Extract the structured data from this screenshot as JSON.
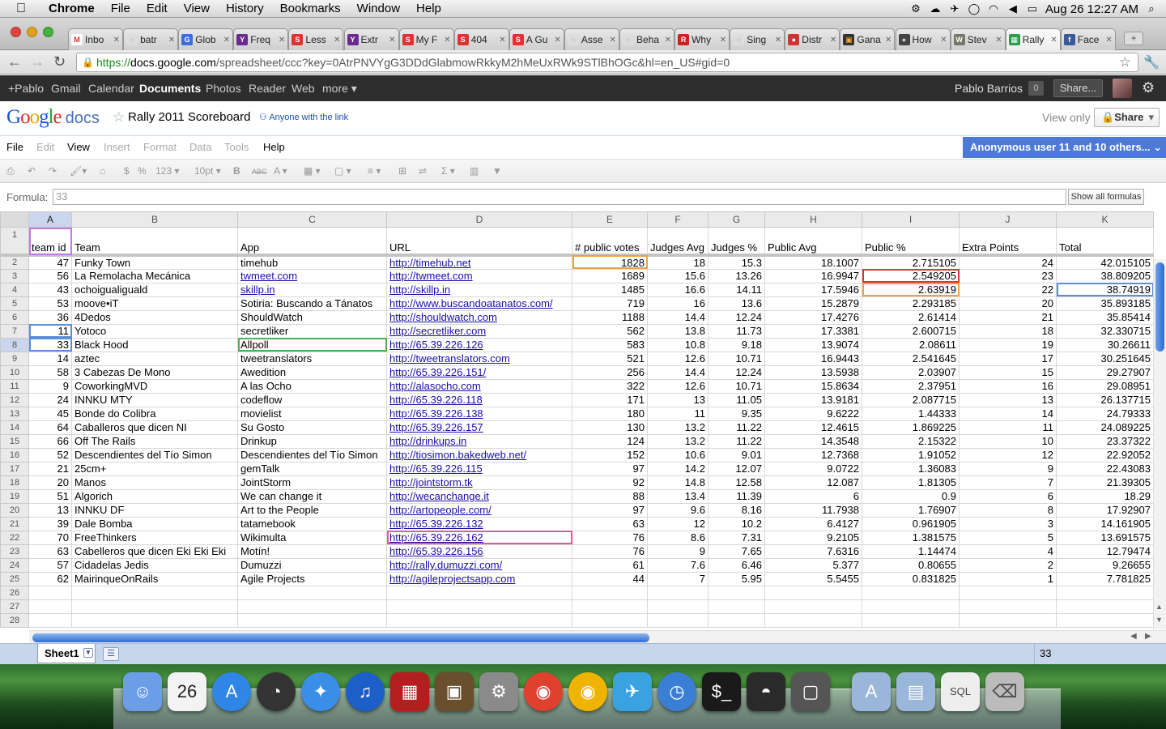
{
  "macos": {
    "menu": [
      "File",
      "Edit",
      "View",
      "History",
      "Bookmarks",
      "Window",
      "Help"
    ],
    "app": "Chrome",
    "datetime": "Aug 26  12:27 AM"
  },
  "tabs": [
    {
      "label": "Inbo",
      "color": "#ffffff",
      "glyph": "M",
      "fg": "#d33"
    },
    {
      "label": "batr",
      "color": "#dddddd",
      "glyph": "◌",
      "fg": "#666"
    },
    {
      "label": "Glob",
      "color": "#3b6fd8",
      "glyph": "G",
      "fg": "#fff"
    },
    {
      "label": "Freq",
      "color": "#6b2a8f",
      "glyph": "Y",
      "fg": "#fff"
    },
    {
      "label": "Less",
      "color": "#d33",
      "glyph": "S",
      "fg": "#fff"
    },
    {
      "label": "Extr",
      "color": "#6b2a8f",
      "glyph": "Y",
      "fg": "#fff"
    },
    {
      "label": "My F",
      "color": "#d33",
      "glyph": "S",
      "fg": "#fff"
    },
    {
      "label": "404",
      "color": "#d33",
      "glyph": "S",
      "fg": "#fff"
    },
    {
      "label": "A Gu",
      "color": "#d33",
      "glyph": "S",
      "fg": "#fff"
    },
    {
      "label": "Asse",
      "color": "#dddddd",
      "glyph": "◌",
      "fg": "#666"
    },
    {
      "label": "Beha",
      "color": "#dddddd",
      "glyph": "◌",
      "fg": "#666"
    },
    {
      "label": "Why",
      "color": "#c22",
      "glyph": "R",
      "fg": "#fff"
    },
    {
      "label": "Sing",
      "color": "#dddddd",
      "glyph": "◌",
      "fg": "#666"
    },
    {
      "label": "Distr",
      "color": "#c33",
      "glyph": "●",
      "fg": "#fff"
    },
    {
      "label": "Gana",
      "color": "#333",
      "glyph": "▣",
      "fg": "#fa3"
    },
    {
      "label": "How",
      "color": "#444",
      "glyph": "●",
      "fg": "#ccc"
    },
    {
      "label": "Stev",
      "color": "#776",
      "glyph": "W",
      "fg": "#fff"
    },
    {
      "label": "Rally",
      "color": "#2e9e48",
      "glyph": "▦",
      "fg": "#fff"
    },
    {
      "label": "Face",
      "color": "#3b5998",
      "glyph": "f",
      "fg": "#fff"
    }
  ],
  "address": {
    "scheme": "https://",
    "host": "docs.google.com",
    "path": "/spreadsheet/ccc?key=0AtrPNVYgG3DDdGlabmowRkkyM2hMeUxRWk9STlBhOGc&hl=en_US#gid=0"
  },
  "googlebar": {
    "links": [
      "+Pablo",
      "Gmail",
      "Calendar",
      "Documents",
      "Photos",
      "Reader",
      "Web",
      "more ▾"
    ],
    "active": "Documents",
    "user": "Pablo Barrios",
    "count": "0",
    "share": "Share..."
  },
  "doc": {
    "logo_google": "Google",
    "logo_docs": "docs",
    "title": "Rally 2011 Scoreboard",
    "visibility": "Anyone with the link",
    "view_only": "View only",
    "share": "Share"
  },
  "menubar": {
    "items": [
      {
        "label": "File",
        "enabled": true
      },
      {
        "label": "Edit",
        "enabled": false
      },
      {
        "label": "View",
        "enabled": true
      },
      {
        "label": "Insert",
        "enabled": false
      },
      {
        "label": "Format",
        "enabled": false
      },
      {
        "label": "Data",
        "enabled": false
      },
      {
        "label": "Tools",
        "enabled": false
      },
      {
        "label": "Help",
        "enabled": true
      }
    ],
    "collaborators": "Anonymous user 11 and 10 others... ⌄"
  },
  "toolbar": {
    "items": [
      "⎙",
      "↶",
      "↷",
      "🖌▾",
      "⌂",
      "$",
      "%",
      "123 ▾",
      "10pt ▾",
      "B",
      "ABC",
      "A ▾",
      "▦ ▾",
      "▢ ▾",
      "≡ ▾",
      "⊞",
      "⇌",
      "Σ ▾",
      "▥",
      "▼"
    ]
  },
  "formula": {
    "label": "Formula:",
    "value": "33",
    "show_all": "Show all formulas"
  },
  "grid": {
    "columns": [
      "A",
      "B",
      "C",
      "D",
      "E",
      "F",
      "G",
      "H",
      "I",
      "J",
      "K"
    ],
    "header_row": [
      "team id",
      "Team",
      "App",
      "URL",
      "# public votes",
      "Judges Avg",
      "Judges %",
      "Public Avg",
      "Public %",
      "Extra Points",
      "Total"
    ],
    "rows": [
      [
        "47",
        "Funky Town",
        "timehub",
        "http://timehub.net",
        "1828",
        "18",
        "15.3",
        "18.1007",
        "2.715105",
        "24",
        "42.015105"
      ],
      [
        "56",
        "La Remolacha Mecánica",
        "twmeet.com",
        "http://twmeet.com",
        "1689",
        "15.6",
        "13.26",
        "16.9947",
        "2.549205",
        "23",
        "38.809205"
      ],
      [
        "43",
        "ochoigualiguald",
        "skillp.in",
        "http://skillp.in",
        "1485",
        "16.6",
        "14.11",
        "17.5946",
        "2.63919",
        "22",
        "38.74919"
      ],
      [
        "53",
        "moove•iT",
        "Sotiria: Buscando a Tánatos",
        "http://www.buscandoatanatos.com/",
        "719",
        "16",
        "13.6",
        "15.2879",
        "2.293185",
        "20",
        "35.893185"
      ],
      [
        "36",
        "4Dedos",
        "ShouldWatch",
        "http://shouldwatch.com",
        "1188",
        "14.4",
        "12.24",
        "17.4276",
        "2.61414",
        "21",
        "35.85414"
      ],
      [
        "11",
        "Yotoco",
        "secretliker",
        "http://secretliker.com",
        "562",
        "13.8",
        "11.73",
        "17.3381",
        "2.600715",
        "18",
        "32.330715"
      ],
      [
        "33",
        "Black Hood",
        "Allpoll",
        "http://65.39.226.126",
        "583",
        "10.8",
        "9.18",
        "13.9074",
        "2.08611",
        "19",
        "30.26611"
      ],
      [
        "14",
        "aztec",
        "tweetranslators",
        "http://tweetranslators.com",
        "521",
        "12.6",
        "10.71",
        "16.9443",
        "2.541645",
        "17",
        "30.251645"
      ],
      [
        "58",
        "3 Cabezas De Mono",
        "Awedition",
        "http://65.39.226.151/",
        "256",
        "14.4",
        "12.24",
        "13.5938",
        "2.03907",
        "15",
        "29.27907"
      ],
      [
        "9",
        "CoworkingMVD",
        "A las Ocho",
        "http://alasocho.com",
        "322",
        "12.6",
        "10.71",
        "15.8634",
        "2.37951",
        "16",
        "29.08951"
      ],
      [
        "24",
        "INNKU MTY",
        "codeflow",
        "http://65.39.226.118",
        "171",
        "13",
        "11.05",
        "13.9181",
        "2.087715",
        "13",
        "26.137715"
      ],
      [
        "45",
        "Bonde do Colibra",
        "movielist",
        "http://65.39.226.138",
        "180",
        "11",
        "9.35",
        "9.6222",
        "1.44333",
        "14",
        "24.79333"
      ],
      [
        "64",
        "Caballeros que dicen NI",
        "Su Gosto",
        "http://65.39.226.157",
        "130",
        "13.2",
        "11.22",
        "12.4615",
        "1.869225",
        "11",
        "24.089225"
      ],
      [
        "66",
        "Off The Rails",
        "Drinkup",
        "http://drinkups.in",
        "124",
        "13.2",
        "11.22",
        "14.3548",
        "2.15322",
        "10",
        "23.37322"
      ],
      [
        "52",
        "Descendientes del Tío Simon",
        "Descendientes del Tío Simon",
        "http://tiosimon.bakedweb.net/",
        "152",
        "10.6",
        "9.01",
        "12.7368",
        "1.91052",
        "12",
        "22.92052"
      ],
      [
        "21",
        "25cm+",
        "gemTalk",
        "http://65.39.226.115",
        "97",
        "14.2",
        "12.07",
        "9.0722",
        "1.36083",
        "9",
        "22.43083"
      ],
      [
        "20",
        "Manos",
        "JointStorm",
        "http://jointstorm.tk",
        "92",
        "14.8",
        "12.58",
        "12.087",
        "1.81305",
        "7",
        "21.39305"
      ],
      [
        "51",
        "Algorich",
        "We can change it",
        "http://wecanchange.it",
        "88",
        "13.4",
        "11.39",
        "6",
        "0.9",
        "6",
        "18.29"
      ],
      [
        "13",
        "INNKU DF",
        "Art to the People",
        "http://artopeople.com/",
        "97",
        "9.6",
        "8.16",
        "11.7938",
        "1.76907",
        "8",
        "17.92907"
      ],
      [
        "39",
        "Dale Bomba",
        "tatamebook",
        "http://65.39.226.132",
        "63",
        "12",
        "10.2",
        "6.4127",
        "0.961905",
        "3",
        "14.161905"
      ],
      [
        "70",
        "FreeThinkers",
        "Wikimulta",
        "http://65.39.226.162",
        "76",
        "8.6",
        "7.31",
        "9.2105",
        "1.381575",
        "5",
        "13.691575"
      ],
      [
        "63",
        "Cabelleros que dicen Eki Eki Eki",
        "Motín!",
        "http://65.39.226.156",
        "76",
        "9",
        "7.65",
        "7.6316",
        "1.14474",
        "4",
        "12.79474"
      ],
      [
        "57",
        "Cidadelas Jedis",
        "Dumuzzi",
        "http://rally.dumuzzi.com/",
        "61",
        "7.6",
        "6.46",
        "5.377",
        "0.80655",
        "2",
        "9.26655"
      ],
      [
        "62",
        "MairinqueOnRails",
        "Agile Projects",
        "http://agileprojectsapp.com",
        "44",
        "7",
        "5.95",
        "5.5455",
        "0.831825",
        "1",
        "7.781825"
      ]
    ],
    "empty_rows": [
      "26",
      "27",
      "28"
    ]
  },
  "sheetbar": {
    "tab": "Sheet1",
    "sum": "33"
  },
  "dock": [
    {
      "name": "finder-icon",
      "bg": "#6c9ee8",
      "g": "☺"
    },
    {
      "name": "calendar-icon",
      "bg": "#f3f3f3",
      "g": "26",
      "fg": "#222"
    },
    {
      "name": "app-store-icon",
      "bg": "#2f86e6",
      "g": "A"
    },
    {
      "name": "dashboard-icon",
      "bg": "#333",
      "g": "◔"
    },
    {
      "name": "safari-icon",
      "bg": "#3a8ee6",
      "g": "✦"
    },
    {
      "name": "itunes-icon",
      "bg": "#1c5fc8",
      "g": "♫"
    },
    {
      "name": "photo-booth-icon",
      "bg": "#b31e1e",
      "g": "▦"
    },
    {
      "name": "iphoto-icon",
      "bg": "#6a4f2f",
      "g": "▣"
    },
    {
      "name": "system-preferences-icon",
      "bg": "#8a8a8a",
      "g": "⚙"
    },
    {
      "name": "chrome-icon",
      "bg": "#e0402e",
      "g": "◉"
    },
    {
      "name": "chrome-canary-icon",
      "bg": "#f0b400",
      "g": "◉"
    },
    {
      "name": "twitter-icon",
      "bg": "#3aa2e0",
      "g": "✈"
    },
    {
      "name": "timer-icon",
      "bg": "#3a7fd4",
      "g": "◷"
    },
    {
      "name": "terminal-icon",
      "bg": "#1a1a1a",
      "g": "$_"
    },
    {
      "name": "adium-icon",
      "bg": "#2a2a2a",
      "g": "◓"
    },
    {
      "name": "preview-icon",
      "bg": "#555",
      "g": "▢"
    },
    {
      "name": "applications-folder-icon",
      "bg": "#9ab6d8",
      "g": "A"
    },
    {
      "name": "documents-folder-icon",
      "bg": "#9ab6d8",
      "g": "▤"
    },
    {
      "name": "sql-file-icon",
      "bg": "#eeeeee",
      "g": "SQL",
      "fg": "#444"
    },
    {
      "name": "trash-icon",
      "bg": "#bbbbbb",
      "g": "⌫",
      "fg": "#444"
    }
  ]
}
